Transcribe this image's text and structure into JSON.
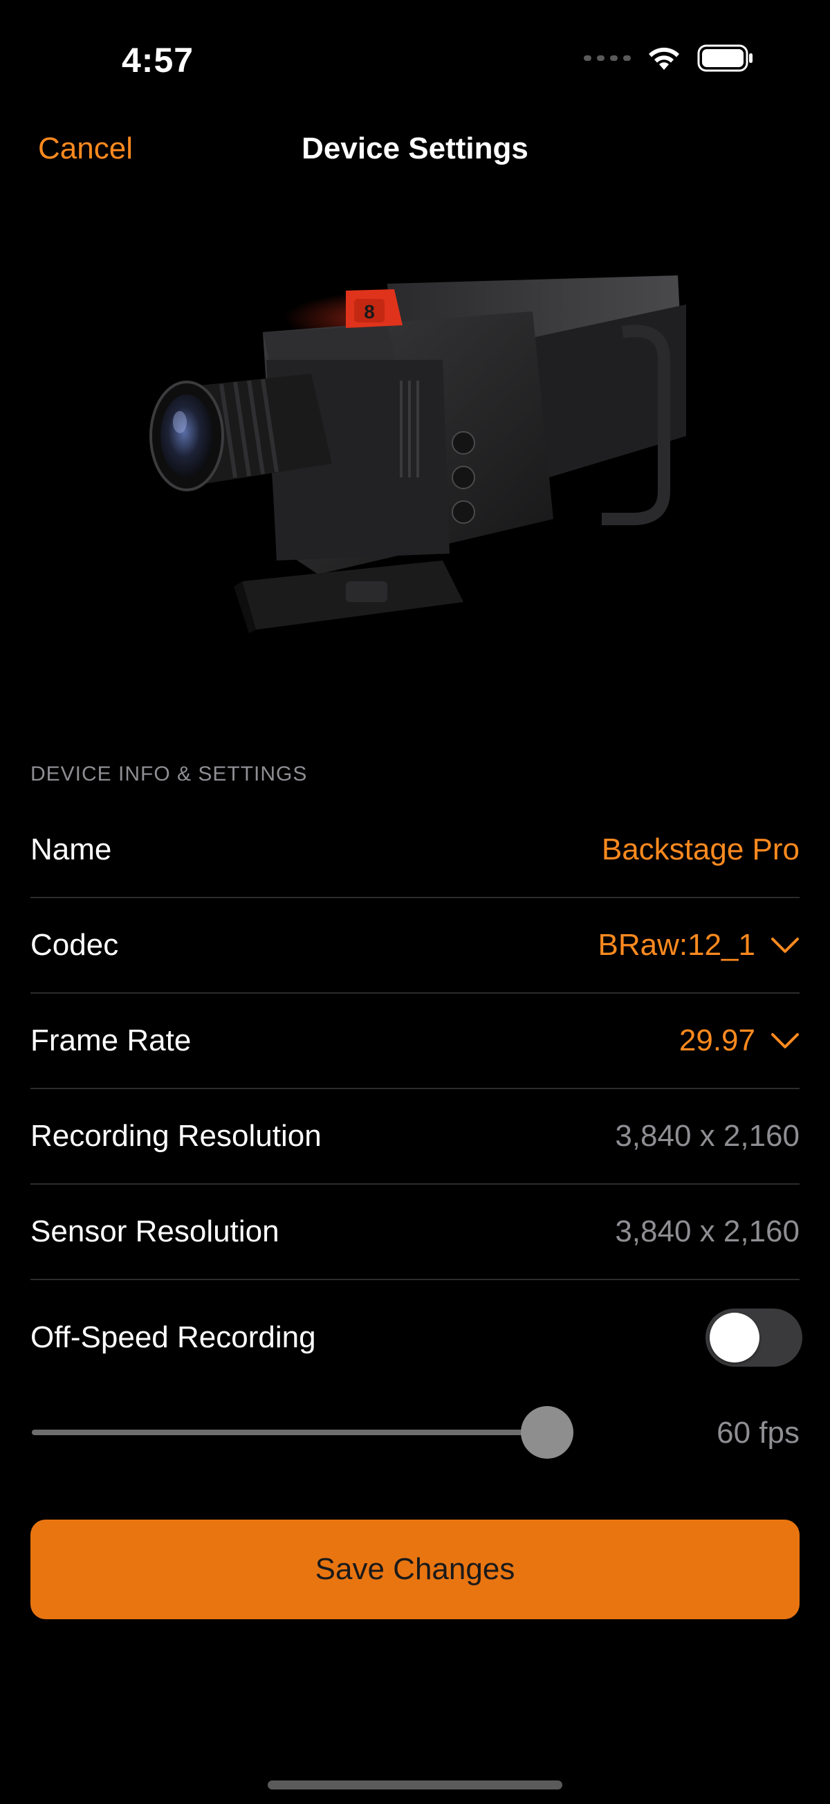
{
  "status_bar": {
    "time": "4:57",
    "icons": [
      "cellular-dots-icon",
      "wifi-icon",
      "battery-icon"
    ]
  },
  "nav": {
    "cancel_label": "Cancel",
    "title": "Device Settings"
  },
  "hero": {
    "image_name": "camera-image",
    "tally_number": "8"
  },
  "section": {
    "header": "DEVICE INFO & SETTINGS",
    "rows": [
      {
        "label": "Name",
        "value": "Backstage Pro"
      },
      {
        "label": "Codec",
        "value": "BRaw:12_1"
      },
      {
        "label": "Frame Rate",
        "value": "29.97"
      },
      {
        "label": "Recording Resolution",
        "value": "3,840 x 2,160"
      },
      {
        "label": "Sensor Resolution",
        "value": "3,840 x 2,160"
      },
      {
        "label": "Off-Speed Recording",
        "toggle_on": false
      }
    ]
  },
  "slider": {
    "value_label": "60 fps",
    "fraction": 0.94
  },
  "save_label": "Save Changes",
  "colors": {
    "accent": "#ff8a1f",
    "button": "#e97511",
    "background": "#000000",
    "secondary_text": "#8e8e93"
  }
}
